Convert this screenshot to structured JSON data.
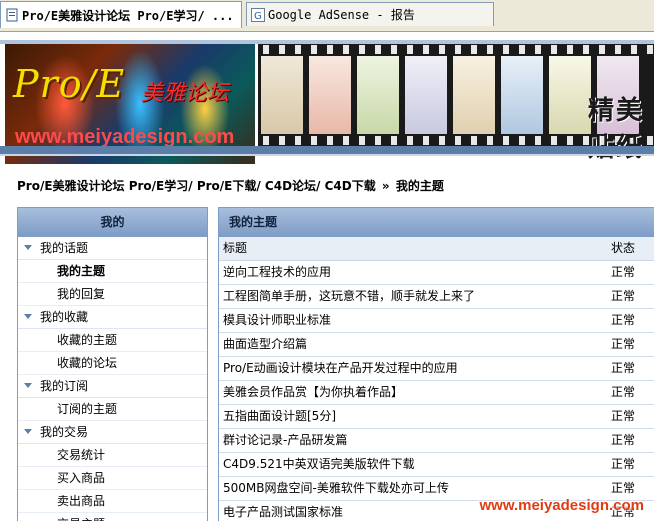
{
  "browser": {
    "tabs": [
      {
        "title": "Pro/E美雅设计论坛 Pro/E学习/ ...",
        "active": true,
        "icon": "page-icon"
      },
      {
        "title": "Google AdSense - 报告",
        "active": false,
        "icon": "google-icon"
      }
    ]
  },
  "banner": {
    "logo_title": "Pro/E",
    "logo_cn": "美雅论坛",
    "logo_url": "www.meiyadesign.com",
    "film_word": "精美贴纸"
  },
  "breadcrumb": {
    "items": [
      "Pro/E美雅设计论坛 Pro/E学习/ Pro/E下载/ C4D论坛/ C4D下载",
      "我的主题"
    ],
    "separator": "»"
  },
  "sidebar": {
    "title": "我的",
    "groups": [
      {
        "label": "我的话题",
        "items": [
          {
            "label": "我的主题",
            "active": true
          },
          {
            "label": "我的回复"
          }
        ]
      },
      {
        "label": "我的收藏",
        "items": [
          {
            "label": "收藏的主题"
          },
          {
            "label": "收藏的论坛"
          }
        ]
      },
      {
        "label": "我的订阅",
        "items": [
          {
            "label": "订阅的主题"
          }
        ]
      },
      {
        "label": "我的交易",
        "items": [
          {
            "label": "交易统计"
          },
          {
            "label": "买入商品"
          },
          {
            "label": "卖出商品"
          },
          {
            "label": "交易主题"
          }
        ]
      }
    ]
  },
  "main": {
    "title": "我的主题",
    "columns": [
      "标题",
      "状态"
    ],
    "rows": [
      {
        "title": "逆向工程技术的应用",
        "status": "正常"
      },
      {
        "title": "工程图简单手册，这玩意不错，顺手就发上来了",
        "status": "正常"
      },
      {
        "title": "模具设计师职业标准",
        "status": "正常"
      },
      {
        "title": "曲面造型介绍篇",
        "status": "正常"
      },
      {
        "title": "Pro/E动画设计模块在产品开发过程中的应用",
        "status": "正常"
      },
      {
        "title": "美雅会员作品赏【为你执着作品】",
        "status": "正常"
      },
      {
        "title": "五指曲面设计题[5分]",
        "status": "正常"
      },
      {
        "title": "群讨论记录-产品研发篇",
        "status": "正常"
      },
      {
        "title": "C4D9.521中英双语完美版软件下载",
        "status": "正常"
      },
      {
        "title": "500MB网盘空间-美雅软件下载处亦可上传",
        "status": "正常"
      },
      {
        "title": "电子产品测试国家标准",
        "status": "正常"
      }
    ]
  },
  "watermark": "www.meiyadesign.com",
  "colors": {
    "header_blue": "#7d9bc6",
    "border_blue": "#7a9cc6",
    "watermark_red": "#e23b12",
    "logo_yellow": "#f4e000"
  }
}
